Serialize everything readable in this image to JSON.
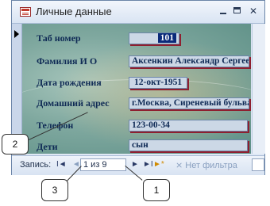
{
  "window": {
    "title": "Личные данные"
  },
  "form": {
    "fields": [
      {
        "label": "Таб номер",
        "value": "101"
      },
      {
        "label": "Фамилия И О",
        "value": "Аксенкин Александр Сергеевич"
      },
      {
        "label": "Дата рождения",
        "value": "12-окт-1951"
      },
      {
        "label": "Домашний адрес",
        "value": "г.Москва, Сиреневый бульвар,"
      },
      {
        "label": "Телефон",
        "value": "123-00-34"
      },
      {
        "label": "Дети",
        "value": "сын"
      }
    ]
  },
  "navigation": {
    "label": "Запись:",
    "first": "I◄",
    "prev": "◄",
    "counter": "1 из 9",
    "next": "►",
    "last": "►I",
    "new": "►*",
    "filter": "Нет фильтра"
  },
  "callouts": {
    "c1": "1",
    "c2": "2",
    "c3": "3"
  },
  "colors": {
    "accent": "#0a2a7a",
    "label": "#0f2a55",
    "field_shadow": "#8f1f2f"
  }
}
